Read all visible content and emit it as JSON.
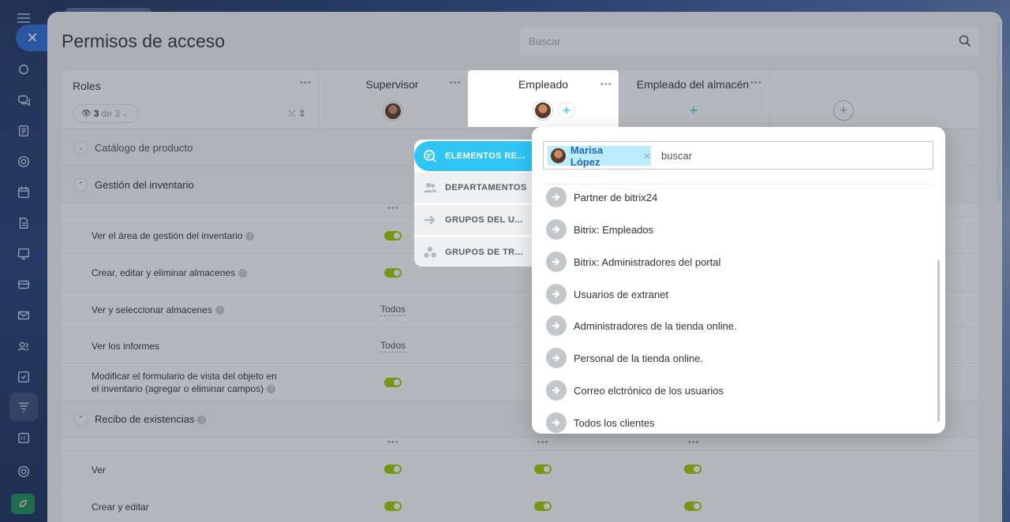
{
  "page": {
    "title": "Permisos de acceso",
    "search_placeholder": "Buscar"
  },
  "header": {
    "roles_label": "Roles",
    "filter": {
      "count": "3",
      "of": "de 3"
    },
    "columns": [
      {
        "name": "Supervisor"
      },
      {
        "name": "Empleado"
      },
      {
        "name": "Empleado del almacén"
      }
    ]
  },
  "sections": {
    "catalog": "Catálogo de producto",
    "inventory": "Gestión del inventario",
    "receipt": "Recibo de existencias"
  },
  "permissions": {
    "p1": "Ver el área de gestión del inventario",
    "p2": "Crear, editar y eliminar almacenes",
    "p3": "Ver y seleccionar almacenes",
    "p4": "Ver los informes",
    "p5a": "Modificar el formulario de vista del objeto en",
    "p5b": "el inventario (agregar o eliminar campos)",
    "r1": "Ver",
    "r2": "Crear y editar",
    "all": "Todos"
  },
  "selector": {
    "tabs": [
      "ELEMENTOS RE...",
      "DEPARTAMENTOS",
      "GRUPOS DEL U...",
      "GRUPOS DE TR..."
    ],
    "selected_chip": "Marisa López",
    "input_placeholder": "buscar",
    "items": [
      "Partner de bitrix24",
      "Bitrix: Empleados",
      "Bitrix: Administradores del portal",
      "Usuarios de extranet",
      "Administradores de la tienda online.",
      "Personal de la tienda online.",
      "Correo elctrónico de los usuarios",
      "Todos los clientes"
    ]
  },
  "colors": {
    "accent": "#2fc6f6",
    "toggle_on": "#9dcf00",
    "chip_bg": "#bcedfc"
  }
}
